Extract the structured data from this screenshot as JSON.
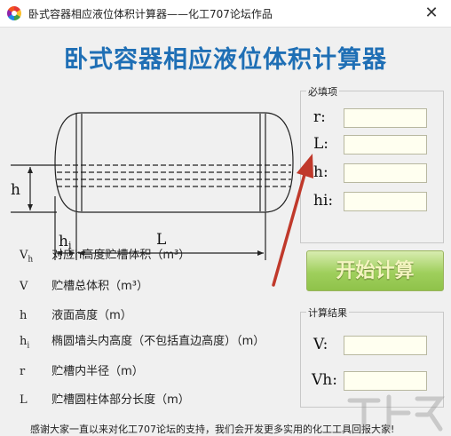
{
  "window": {
    "title": "卧式容器相应液位体积计算器——化工707论坛作品",
    "close_glyph": "✕"
  },
  "main_title": "卧式容器相应液位体积计算器",
  "diagram": {
    "h_label": "h",
    "hi_label": "h",
    "hi_sub": "i",
    "L_label": "L"
  },
  "legend": [
    {
      "sym": "V",
      "sub": "h",
      "text": "对应h高度贮槽体积（m³）"
    },
    {
      "sym": "V",
      "sub": "",
      "text": "贮槽总体积（m³）"
    },
    {
      "sym": "h",
      "sub": "",
      "text": "液面高度（m）"
    },
    {
      "sym": "h",
      "sub": "i",
      "text": "椭圆墙头内高度（不包括直边高度）（m）"
    },
    {
      "sym": "r",
      "sub": "",
      "text": "贮槽内半径（m）"
    },
    {
      "sym": "L",
      "sub": "",
      "text": "贮槽圆柱体部分长度（m）"
    }
  ],
  "required_group": {
    "label": "必填项",
    "fields": [
      {
        "label": "r:",
        "value": ""
      },
      {
        "label": "L:",
        "value": ""
      },
      {
        "label": "h:",
        "value": ""
      },
      {
        "label": "hi:",
        "value": ""
      }
    ]
  },
  "start_button": "开始计算",
  "result_group": {
    "label": "计算结果",
    "fields": [
      {
        "label": "V:",
        "value": ""
      },
      {
        "label": "Vh:",
        "value": ""
      }
    ]
  },
  "footer": "感谢大家一直以来对化工707论坛的支持，我们会开发更多实用的化工工具回报大家!",
  "colors": {
    "title_blue": "#1f6fb5",
    "button_green": "#9fcf5c",
    "arrow_red": "#c0392b",
    "input_bg": "#fffff0"
  }
}
